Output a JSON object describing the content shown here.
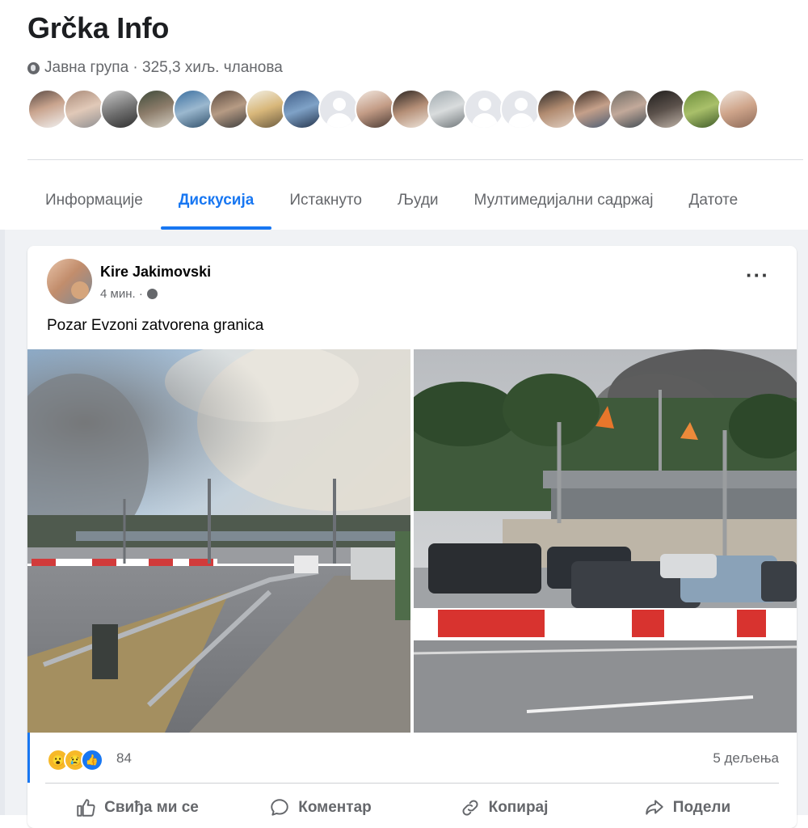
{
  "group": {
    "title": "Grčka Info",
    "meta": "Јавна група · 325,3 хиљ. чланова"
  },
  "tabs": [
    {
      "label": "Информације",
      "active": false
    },
    {
      "label": "Дискусија",
      "active": true
    },
    {
      "label": "Истакнуто",
      "active": false
    },
    {
      "label": "Људи",
      "active": false
    },
    {
      "label": "Мултимедијални садржај",
      "active": false
    },
    {
      "label": "Датоте",
      "active": false
    }
  ],
  "post": {
    "author": "Kire Jakimovski",
    "timestamp": "4 мин. ·",
    "text": "Pozar Evzoni zatvorena granica",
    "reaction_count": "84",
    "shares": "5 дељења",
    "reactions": [
      "wow-emoji",
      "sad-emoji",
      "like-emoji"
    ]
  },
  "actions": {
    "like": "Свиђа ми се",
    "comment": "Коментар",
    "copy": "Копирај",
    "share": "Подели"
  },
  "colors": {
    "accent": "#1877f2",
    "secondary_text": "#65676b",
    "feed_background": "#f0f2f5"
  }
}
